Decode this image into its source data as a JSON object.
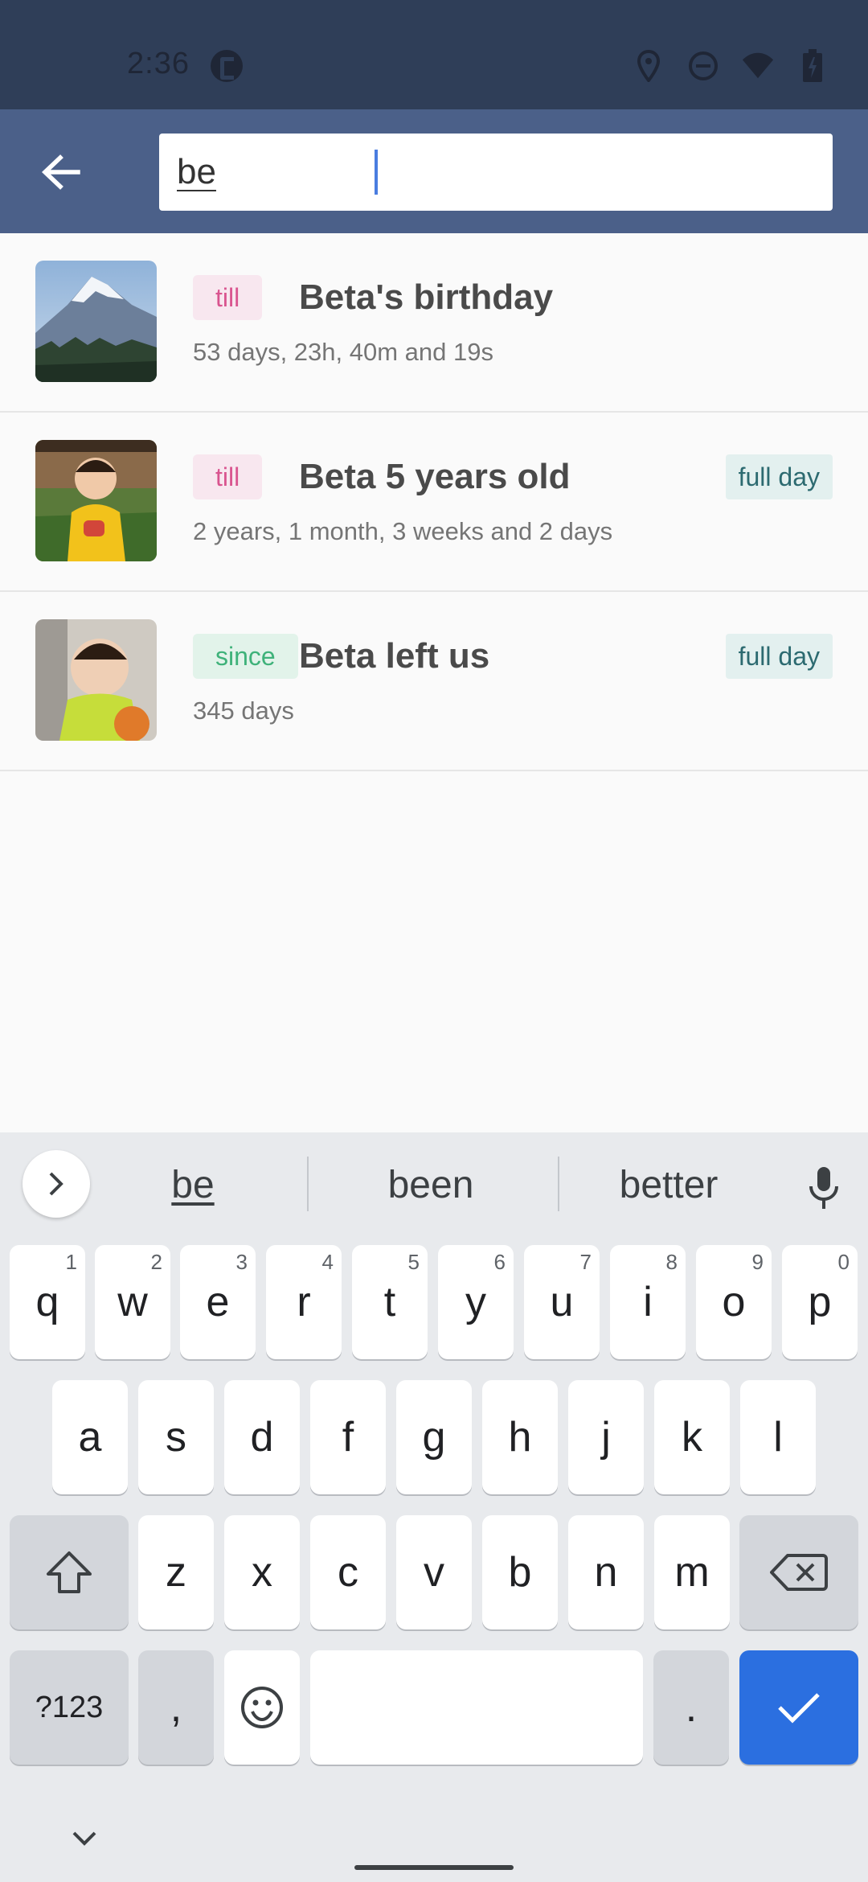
{
  "status_bar": {
    "time": "2:36",
    "icons": [
      "location-icon",
      "dnd-icon",
      "wifi-icon",
      "battery-icon"
    ]
  },
  "toolbar": {
    "back_icon": "arrow-back-icon",
    "search_value": "be"
  },
  "events": [
    {
      "tag": "till",
      "tag_kind": "till",
      "title": "Beta's birthday",
      "subtitle": "53 days, 23h, 40m and 19s",
      "badge": "",
      "thumb": "mountain"
    },
    {
      "tag": "till",
      "tag_kind": "till",
      "title": "Beta 5 years old",
      "subtitle": "2 years, 1 month, 3 weeks and 2 days",
      "badge": "full day",
      "thumb": "child-yellow"
    },
    {
      "tag": "since",
      "tag_kind": "since",
      "title": "Beta left us",
      "subtitle": "345 days",
      "badge": "full day",
      "thumb": "baby-bib"
    }
  ],
  "keyboard": {
    "suggestions": [
      "be",
      "been",
      "better"
    ],
    "row1": [
      [
        "q",
        "1"
      ],
      [
        "w",
        "2"
      ],
      [
        "e",
        "3"
      ],
      [
        "r",
        "4"
      ],
      [
        "t",
        "5"
      ],
      [
        "y",
        "6"
      ],
      [
        "u",
        "7"
      ],
      [
        "i",
        "8"
      ],
      [
        "o",
        "9"
      ],
      [
        "p",
        "0"
      ]
    ],
    "row2": [
      "a",
      "s",
      "d",
      "f",
      "g",
      "h",
      "j",
      "k",
      "l"
    ],
    "row3": [
      "z",
      "x",
      "c",
      "v",
      "b",
      "n",
      "m"
    ],
    "symbols_label": "?123",
    "comma_label": ",",
    "period_label": "."
  },
  "colors": {
    "status_bar": "#2f3e58",
    "toolbar": "#4b6089",
    "till": "#d9548f",
    "since": "#3fb27a",
    "enter_key": "#2b6fe0"
  }
}
